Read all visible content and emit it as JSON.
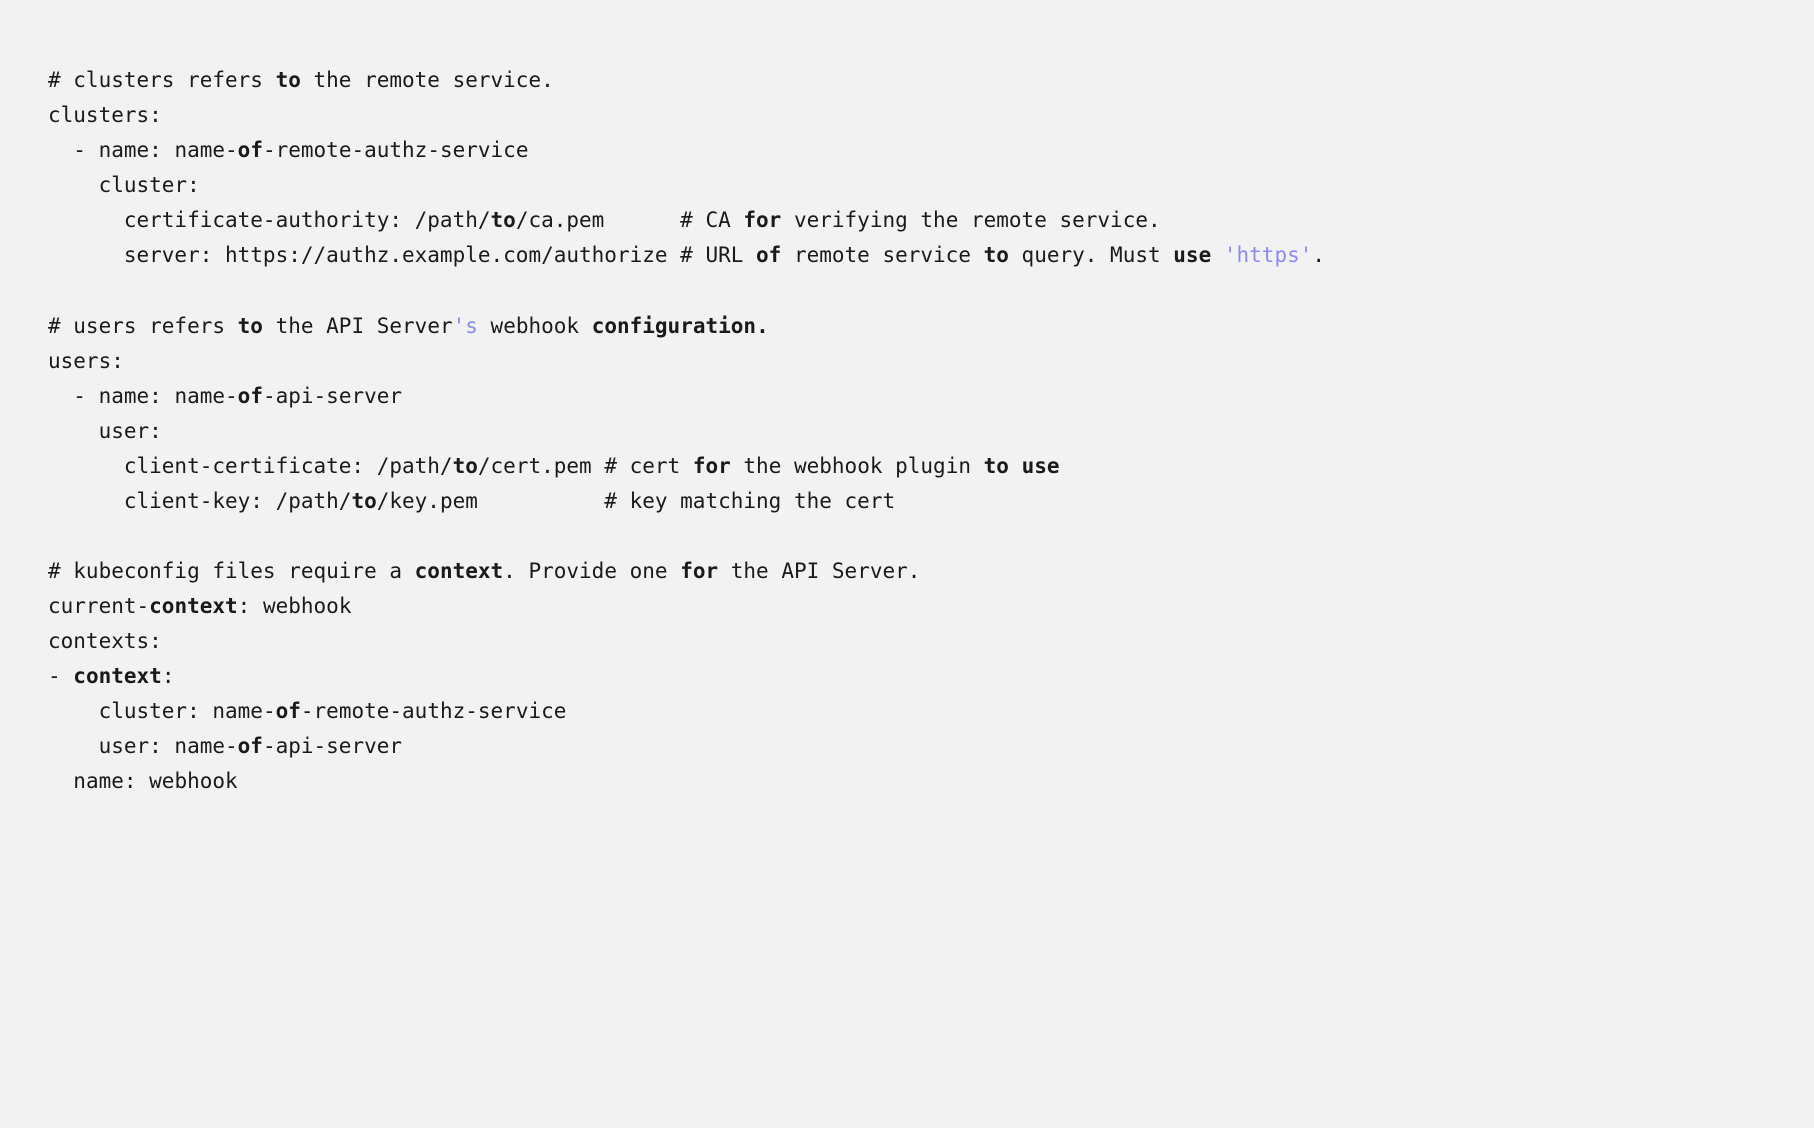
{
  "tokens": {
    "t1": "# clusters refers ",
    "t2": "to",
    "t3": " the remote service.\nclusters:\n  - name: name-",
    "t4": "of",
    "t5": "-remote-authz-service\n    cluster:\n      certificate-authority: /path/",
    "t6": "to",
    "t7": "/ca.pem      # CA ",
    "t8": "for",
    "t9": " verifying the remote service.\n      server: https://authz.example.com/authorize # URL ",
    "t10": "of",
    "t11": " remote service ",
    "t12": "to",
    "t13": " query. Must ",
    "t14": "use",
    "t15": " ",
    "t16": "'https'",
    "t17": ".\n\n# users refers ",
    "t18": "to",
    "t19": " the API Server",
    "t20": "'s",
    "t21": " webhook ",
    "t22": "configuration.",
    "t23": "\nusers:\n  - name: name-",
    "t24": "of",
    "t25": "-api-server\n    user:\n      client-certificate: /path/",
    "t26": "to",
    "t27": "/cert.pem # cert ",
    "t28": "for",
    "t29": " the webhook plugin ",
    "t30": "to",
    "t31": " ",
    "t32": "use",
    "t33": "\n      client-key: /path/",
    "t34": "to",
    "t35": "/key.pem          # key matching the cert\n\n# kubeconfig files require a ",
    "t36": "context",
    "t37": ". Provide one ",
    "t38": "for",
    "t39": " the API Server.\ncurrent-",
    "t40": "context",
    "t41": ": webhook\ncontexts:\n- ",
    "t42": "context",
    "t43": ":\n    cluster: name-",
    "t44": "of",
    "t45": "-remote-authz-service\n    user: name-",
    "t46": "of",
    "t47": "-api-server\n  name: webhook"
  }
}
